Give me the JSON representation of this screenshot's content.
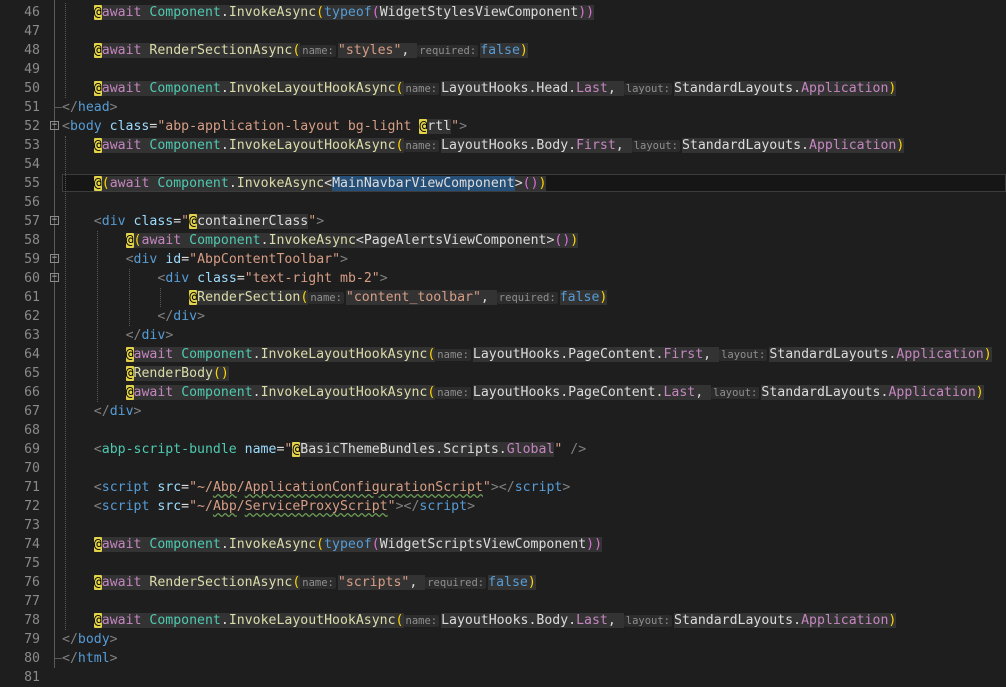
{
  "lines": [
    {
      "n": "46",
      "tokens": [
        [
          "at",
          "@"
        ],
        [
          "razor:kw-r",
          "await "
        ],
        [
          "razor:type",
          "Component"
        ],
        [
          "razor:plain",
          "."
        ],
        [
          "razor:method",
          "InvokeAsync"
        ],
        [
          "razor:gold",
          "("
        ],
        [
          "razor:kw",
          "typeof"
        ],
        [
          "razor:mag",
          "("
        ],
        [
          "razor:plain",
          "WidgetStylesViewComponent"
        ],
        [
          "razor:mag",
          "))"
        ]
      ]
    },
    {
      "n": "47",
      "tokens": []
    },
    {
      "n": "48",
      "tokens": [
        [
          "at",
          "@"
        ],
        [
          "razor:kw-r",
          "await "
        ],
        [
          "razor:method",
          "RenderSectionAsync"
        ],
        [
          "razor:gold",
          "("
        ],
        [
          "hint",
          "name:"
        ],
        [
          "razor:str",
          "\"styles\""
        ],
        [
          "razor:plain",
          ", "
        ],
        [
          "hint",
          "required:"
        ],
        [
          "razor:bool",
          "false"
        ],
        [
          "razor:gold",
          ")"
        ]
      ]
    },
    {
      "n": "49",
      "tokens": []
    },
    {
      "n": "50",
      "tokens": [
        [
          "at",
          "@"
        ],
        [
          "razor:kw-r",
          "await "
        ],
        [
          "razor:type",
          "Component"
        ],
        [
          "razor:plain",
          "."
        ],
        [
          "razor:method",
          "InvokeLayoutHookAsync"
        ],
        [
          "razor:gold",
          "("
        ],
        [
          "hint",
          "name:"
        ],
        [
          "razor:plain",
          "LayoutHooks.Head."
        ],
        [
          "razor:prop",
          "Last"
        ],
        [
          "razor:plain",
          ", "
        ],
        [
          "hint",
          "layout:"
        ],
        [
          "razor:plain",
          "StandardLayouts."
        ],
        [
          "razor:prop",
          "Application"
        ],
        [
          "razor:gold",
          ")"
        ]
      ]
    },
    {
      "n": "51",
      "tokens": [
        [
          "delim",
          "</"
        ],
        [
          "tag",
          "head"
        ],
        [
          "delim",
          ">"
        ]
      ]
    },
    {
      "n": "52",
      "tokens": [
        [
          "delim",
          "<"
        ],
        [
          "tag",
          "body "
        ],
        [
          "attr",
          "class"
        ],
        [
          "plain",
          "="
        ],
        [
          "str",
          "\"abp-application-layout bg-light "
        ],
        [
          "at",
          "@"
        ],
        [
          "razor:plain",
          "rtl"
        ],
        [
          "str",
          "\""
        ],
        [
          "delim",
          ">"
        ]
      ]
    },
    {
      "n": "53",
      "tokens": [
        [
          "at",
          "@"
        ],
        [
          "razor:kw-r",
          "await "
        ],
        [
          "razor:type",
          "Component"
        ],
        [
          "razor:plain",
          "."
        ],
        [
          "razor:method",
          "InvokeLayoutHookAsync"
        ],
        [
          "razor:gold",
          "("
        ],
        [
          "hint",
          "name:"
        ],
        [
          "razor:plain",
          "LayoutHooks.Body."
        ],
        [
          "razor:prop",
          "First"
        ],
        [
          "razor:plain",
          ", "
        ],
        [
          "hint",
          "layout:"
        ],
        [
          "razor:plain",
          "StandardLayouts."
        ],
        [
          "razor:prop",
          "Application"
        ],
        [
          "razor:gold",
          ")"
        ]
      ]
    },
    {
      "n": "54",
      "tokens": []
    },
    {
      "n": "55",
      "tokens": [
        [
          "at",
          "@"
        ],
        [
          "razor:gold",
          "("
        ],
        [
          "razor:kw-r",
          "await "
        ],
        [
          "razor:type",
          "Component"
        ],
        [
          "razor:plain",
          "."
        ],
        [
          "razor:method",
          "InvokeAsync"
        ],
        [
          "razor:plain",
          "<"
        ],
        [
          "sel",
          "MainNavbarViewComponent"
        ],
        [
          "razor:plain",
          ">"
        ],
        [
          "razor:mag",
          "()"
        ],
        [
          "razor:gold",
          ")"
        ]
      ]
    },
    {
      "n": "56",
      "tokens": []
    },
    {
      "n": "57",
      "tokens": [
        [
          "delim",
          "<"
        ],
        [
          "tag",
          "div "
        ],
        [
          "attr",
          "class"
        ],
        [
          "plain",
          "="
        ],
        [
          "str",
          "\""
        ],
        [
          "at",
          "@"
        ],
        [
          "razor:plain",
          "containerClass"
        ],
        [
          "str",
          "\""
        ],
        [
          "delim",
          ">"
        ]
      ]
    },
    {
      "n": "58",
      "tokens": [
        [
          "at",
          "@"
        ],
        [
          "razor:gold",
          "("
        ],
        [
          "razor:kw-r",
          "await "
        ],
        [
          "razor:type",
          "Component"
        ],
        [
          "razor:plain",
          "."
        ],
        [
          "razor:method",
          "InvokeAsync"
        ],
        [
          "razor:plain",
          "<PageAlertsViewComponent>"
        ],
        [
          "razor:mag",
          "()"
        ],
        [
          "razor:gold",
          ")"
        ]
      ]
    },
    {
      "n": "59",
      "tokens": [
        [
          "delim",
          "<"
        ],
        [
          "tag",
          "div "
        ],
        [
          "attr",
          "id"
        ],
        [
          "plain",
          "="
        ],
        [
          "str",
          "\"AbpContentToolbar\""
        ],
        [
          "delim",
          ">"
        ]
      ]
    },
    {
      "n": "60",
      "tokens": [
        [
          "delim",
          "<"
        ],
        [
          "tag",
          "div "
        ],
        [
          "attr",
          "class"
        ],
        [
          "plain",
          "="
        ],
        [
          "str",
          "\"text-right mb-2\""
        ],
        [
          "delim",
          ">"
        ]
      ]
    },
    {
      "n": "61",
      "tokens": [
        [
          "at",
          "@"
        ],
        [
          "razor:method",
          "RenderSection"
        ],
        [
          "razor:gold",
          "("
        ],
        [
          "hint",
          "name:"
        ],
        [
          "razor:str",
          "\"content_toolbar\""
        ],
        [
          "razor:plain",
          ", "
        ],
        [
          "hint",
          "required:"
        ],
        [
          "razor:bool",
          "false"
        ],
        [
          "razor:gold",
          ")"
        ]
      ]
    },
    {
      "n": "62",
      "tokens": [
        [
          "delim",
          "</"
        ],
        [
          "tag",
          "div"
        ],
        [
          "delim",
          ">"
        ]
      ]
    },
    {
      "n": "63",
      "tokens": [
        [
          "delim",
          "</"
        ],
        [
          "tag",
          "div"
        ],
        [
          "delim",
          ">"
        ]
      ]
    },
    {
      "n": "64",
      "tokens": [
        [
          "at",
          "@"
        ],
        [
          "razor:kw-r",
          "await "
        ],
        [
          "razor:type",
          "Component"
        ],
        [
          "razor:plain",
          "."
        ],
        [
          "razor:method",
          "InvokeLayoutHookAsync"
        ],
        [
          "razor:gold",
          "("
        ],
        [
          "hint",
          "name:"
        ],
        [
          "razor:plain",
          "LayoutHooks.PageContent."
        ],
        [
          "razor:prop",
          "First"
        ],
        [
          "razor:plain",
          ", "
        ],
        [
          "hint",
          "layout:"
        ],
        [
          "razor:plain",
          "StandardLayouts."
        ],
        [
          "razor:prop",
          "Application"
        ],
        [
          "razor:gold",
          ")"
        ]
      ]
    },
    {
      "n": "65",
      "tokens": [
        [
          "at",
          "@"
        ],
        [
          "razor:method",
          "RenderBody"
        ],
        [
          "razor:gold",
          "()"
        ]
      ]
    },
    {
      "n": "66",
      "tokens": [
        [
          "at",
          "@"
        ],
        [
          "razor:kw-r",
          "await "
        ],
        [
          "razor:type",
          "Component"
        ],
        [
          "razor:plain",
          "."
        ],
        [
          "razor:method",
          "InvokeLayoutHookAsync"
        ],
        [
          "razor:gold",
          "("
        ],
        [
          "hint",
          "name:"
        ],
        [
          "razor:plain",
          "LayoutHooks.PageContent."
        ],
        [
          "razor:prop",
          "Last"
        ],
        [
          "razor:plain",
          ", "
        ],
        [
          "hint",
          "layout:"
        ],
        [
          "razor:plain",
          "StandardLayouts."
        ],
        [
          "razor:prop",
          "Application"
        ],
        [
          "razor:gold",
          ")"
        ]
      ]
    },
    {
      "n": "67",
      "tokens": [
        [
          "delim",
          "</"
        ],
        [
          "tag",
          "div"
        ],
        [
          "delim",
          ">"
        ]
      ]
    },
    {
      "n": "68",
      "tokens": []
    },
    {
      "n": "69",
      "tokens": [
        [
          "delim",
          "<"
        ],
        [
          "type",
          "abp-script-bundle "
        ],
        [
          "attr",
          "name"
        ],
        [
          "plain",
          "="
        ],
        [
          "str",
          "\""
        ],
        [
          "at",
          "@"
        ],
        [
          "razor:plain",
          "BasicThemeBundles.Scripts."
        ],
        [
          "razor:prop",
          "Global"
        ],
        [
          "str",
          "\""
        ],
        [
          "plain",
          " "
        ],
        [
          "delim",
          "/>"
        ]
      ]
    },
    {
      "n": "70",
      "tokens": []
    },
    {
      "n": "71",
      "tokens": [
        [
          "delim",
          "<"
        ],
        [
          "tag",
          "script "
        ],
        [
          "attr",
          "src"
        ],
        [
          "plain",
          "="
        ],
        [
          "str",
          "\"~/"
        ],
        [
          "str-u",
          "Abp"
        ],
        [
          "str",
          "/"
        ],
        [
          "str-u",
          "ApplicationConfigurationScript"
        ],
        [
          "str",
          "\""
        ],
        [
          "delim",
          "></"
        ],
        [
          "tag",
          "script"
        ],
        [
          "delim",
          ">"
        ]
      ]
    },
    {
      "n": "72",
      "tokens": [
        [
          "delim",
          "<"
        ],
        [
          "tag",
          "script "
        ],
        [
          "attr",
          "src"
        ],
        [
          "plain",
          "="
        ],
        [
          "str",
          "\"~/"
        ],
        [
          "str-u",
          "Abp"
        ],
        [
          "str",
          "/"
        ],
        [
          "str-u",
          "ServiceProxyScript"
        ],
        [
          "str",
          "\""
        ],
        [
          "delim",
          "></"
        ],
        [
          "tag",
          "script"
        ],
        [
          "delim",
          ">"
        ]
      ]
    },
    {
      "n": "73",
      "tokens": []
    },
    {
      "n": "74",
      "tokens": [
        [
          "at",
          "@"
        ],
        [
          "razor:kw-r",
          "await "
        ],
        [
          "razor:type",
          "Component"
        ],
        [
          "razor:plain",
          "."
        ],
        [
          "razor:method",
          "InvokeAsync"
        ],
        [
          "razor:gold",
          "("
        ],
        [
          "razor:kw",
          "typeof"
        ],
        [
          "razor:mag",
          "("
        ],
        [
          "razor:plain",
          "WidgetScriptsViewComponent"
        ],
        [
          "razor:mag",
          "))"
        ]
      ]
    },
    {
      "n": "75",
      "tokens": []
    },
    {
      "n": "76",
      "tokens": [
        [
          "at",
          "@"
        ],
        [
          "razor:kw-r",
          "await "
        ],
        [
          "razor:method",
          "RenderSectionAsync"
        ],
        [
          "razor:gold",
          "("
        ],
        [
          "hint",
          "name:"
        ],
        [
          "razor:str",
          "\"scripts\""
        ],
        [
          "razor:plain",
          ", "
        ],
        [
          "hint",
          "required:"
        ],
        [
          "razor:bool",
          "false"
        ],
        [
          "razor:gold",
          ")"
        ]
      ]
    },
    {
      "n": "77",
      "tokens": []
    },
    {
      "n": "78",
      "tokens": [
        [
          "at",
          "@"
        ],
        [
          "razor:kw-r",
          "await "
        ],
        [
          "razor:type",
          "Component"
        ],
        [
          "razor:plain",
          "."
        ],
        [
          "razor:method",
          "InvokeLayoutHookAsync"
        ],
        [
          "razor:gold",
          "("
        ],
        [
          "hint",
          "name:"
        ],
        [
          "razor:plain",
          "LayoutHooks.Body."
        ],
        [
          "razor:prop",
          "Last"
        ],
        [
          "razor:plain",
          ", "
        ],
        [
          "hint",
          "layout:"
        ],
        [
          "razor:plain",
          "StandardLayouts."
        ],
        [
          "razor:prop",
          "Application"
        ],
        [
          "razor:gold",
          ")"
        ]
      ]
    },
    {
      "n": "79",
      "tokens": [
        [
          "delim",
          "</"
        ],
        [
          "tag",
          "body"
        ],
        [
          "delim",
          ">"
        ]
      ]
    },
    {
      "n": "80",
      "tokens": [
        [
          "delim",
          "</"
        ],
        [
          "tag",
          "html"
        ],
        [
          "delim",
          ">"
        ]
      ]
    },
    {
      "n": "81",
      "tokens": []
    }
  ]
}
